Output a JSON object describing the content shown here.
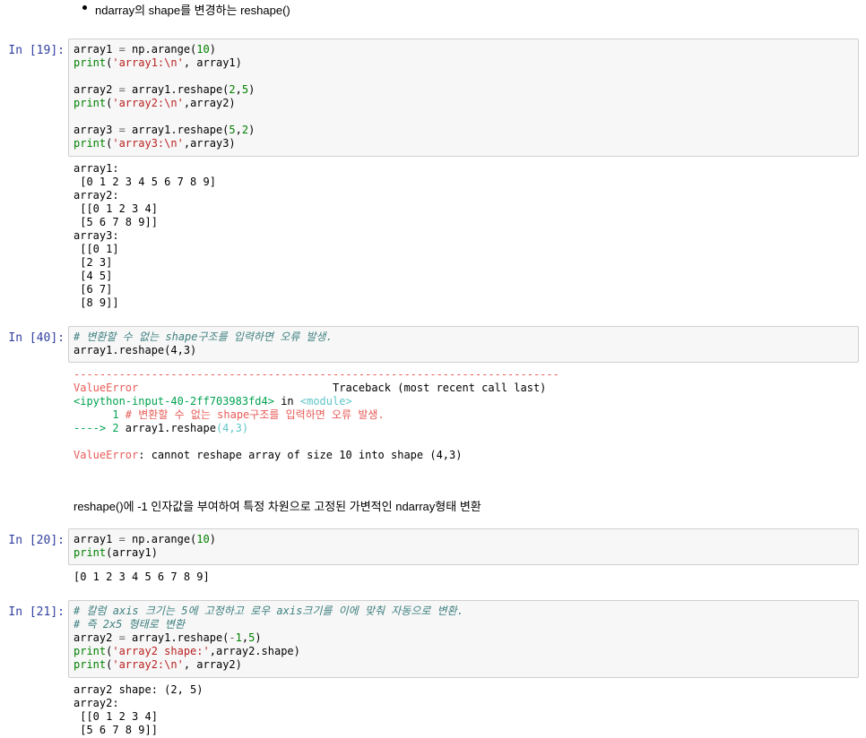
{
  "markdown": {
    "top_bullet": "ndarray의 shape를 변경하는 reshape()",
    "section2": "reshape()에 -1 인자값을 부여하여 특정 차원으로 고정된 가변적인 ndarray형태 변환"
  },
  "cells": [
    {
      "prompt": "In [19]:",
      "code": {
        "l1_a": "array1 ",
        "l1_op": "=",
        "l1_b": " np.arange(",
        "l1_num": "10",
        "l1_c": ")",
        "l2_fn": "print",
        "l2_a": "(",
        "l2_str": "'array1:\\n'",
        "l2_b": ", array1)",
        "l4_a": "array2 ",
        "l4_op": "=",
        "l4_b": " array1.reshape(",
        "l4_n1": "2",
        "l4_comma": ",",
        "l4_n2": "5",
        "l4_c": ")",
        "l5_fn": "print",
        "l5_a": "(",
        "l5_str": "'array2:\\n'",
        "l5_b": ",array2)",
        "l7_a": "array3 ",
        "l7_op": "=",
        "l7_b": " array1.reshape(",
        "l7_n1": "5",
        "l7_comma": ",",
        "l7_n2": "2",
        "l7_c": ")",
        "l8_fn": "print",
        "l8_a": "(",
        "l8_str": "'array3:\\n'",
        "l8_b": ",array3)"
      },
      "output": "array1:\n [0 1 2 3 4 5 6 7 8 9]\narray2:\n [[0 1 2 3 4]\n [5 6 7 8 9]]\narray3:\n [[0 1]\n [2 3]\n [4 5]\n [6 7]\n [8 9]]"
    },
    {
      "prompt": "In [40]:",
      "code": {
        "comment": "# 변환할 수 없는 shape구조를 입력하면 오류 발생.",
        "l2": "array1.reshape(4,3)"
      },
      "error": {
        "rule": "---------------------------------------------------------------------------",
        "name": "ValueError",
        "traceback_head": "                              Traceback (most recent call last)",
        "input_file": "<ipython-input-40-2ff703983fd4>",
        "in_word": " in ",
        "module": "<module>",
        "line1_num": "      1 ",
        "line1_text": "# 변환할 수 없는 shape구조를 입력하면 오류 발생.",
        "arrow": "----> 2 ",
        "arrow_code": "array1.reshape",
        "arrow_args": "(4,3)",
        "final_name": "ValueError",
        "final_msg": ": cannot reshape array of size 10 into shape (4,3)"
      }
    },
    {
      "prompt": "In [20]:",
      "code": {
        "l1_a": "array1 ",
        "l1_op": "=",
        "l1_b": " np.arange(",
        "l1_num": "10",
        "l1_c": ")",
        "l2_fn": "print",
        "l2_b": "(array1)"
      },
      "output": "[0 1 2 3 4 5 6 7 8 9]"
    },
    {
      "prompt": "In [21]:",
      "code": {
        "c1": "# 칼럼 axis 크기는 5에 고정하고 로우 axis크기를 이에 맞춰 자동으로 변환.",
        "c2": "# 즉 2x5 형태로 변환",
        "l3_a": "array2 ",
        "l3_op": "=",
        "l3_b": " array1.reshape(",
        "l3_neg": "-",
        "l3_n1": "1",
        "l3_comma": ",",
        "l3_n2": "5",
        "l3_c": ")",
        "l4_fn": "print",
        "l4_a": "(",
        "l4_str": "'array2 shape:'",
        "l4_b": ",array2.shape)",
        "l5_fn": "print",
        "l5_a": "(",
        "l5_str": "'array2:\\n'",
        "l5_b": ", array2)"
      },
      "output": "array2 shape: (2, 5)\narray2:\n [[0 1 2 3 4]\n [5 6 7 8 9]]"
    }
  ]
}
